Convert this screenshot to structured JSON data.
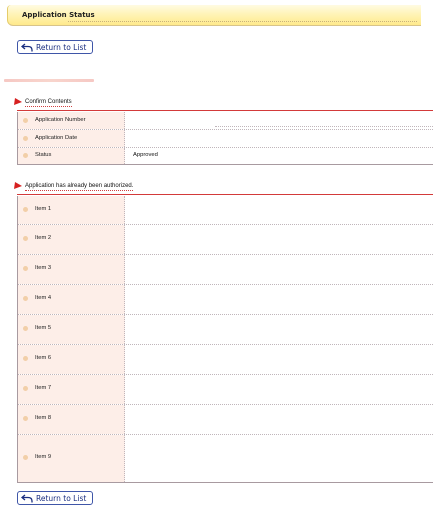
{
  "page": {
    "title": "Application Status"
  },
  "buttons": {
    "return_label": "Return to List"
  },
  "confirm": {
    "heading": "Confirm Contents",
    "rows": [
      {
        "label": "Application Number",
        "value": ""
      },
      {
        "label": "Application Date",
        "value": ""
      },
      {
        "label": "Status",
        "value": "Approved"
      }
    ]
  },
  "authorized": {
    "heading": "Application has already been authorized.",
    "items": [
      {
        "label": "Item 1"
      },
      {
        "label": "Item 2"
      },
      {
        "label": "Item 3"
      },
      {
        "label": "Item 4"
      },
      {
        "label": "Item 5"
      },
      {
        "label": "Item 6"
      },
      {
        "label": "Item 7"
      },
      {
        "label": "Item 8"
      },
      {
        "label": "Item 9"
      }
    ]
  },
  "colors": {
    "accent_red": "#d33a3a",
    "link_blue": "#1a2e80",
    "label_bg": "#fdeee8"
  }
}
